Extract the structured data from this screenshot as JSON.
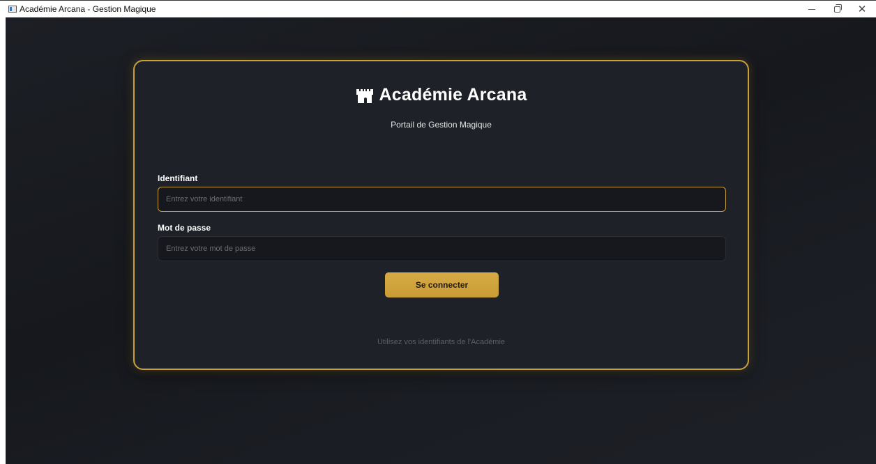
{
  "window": {
    "title": "Académie Arcana - Gestion Magique"
  },
  "brand": {
    "icon": "castle-icon",
    "title": "Académie Arcana",
    "subtitle": "Portail de Gestion Magique"
  },
  "form": {
    "username": {
      "label": "Identifiant",
      "placeholder": "Entrez votre identifiant",
      "value": ""
    },
    "password": {
      "label": "Mot de passe",
      "placeholder": "Entrez votre mot de passe",
      "value": ""
    },
    "submit_label": "Se connecter"
  },
  "footer": {
    "note": "Utilisez vos identifiants de l'Académie"
  },
  "colors": {
    "accent": "#c9a13a",
    "background": "#16181d",
    "card": "#1e2128"
  }
}
